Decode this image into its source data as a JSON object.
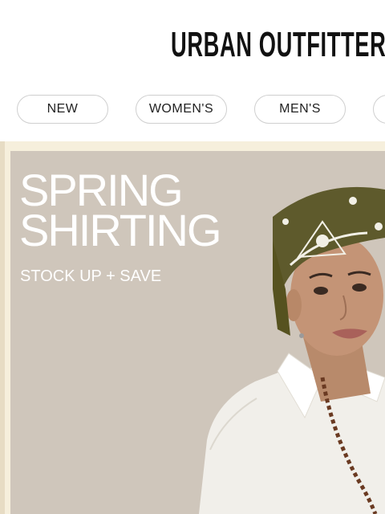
{
  "header": {
    "logo": "URBAN OUTFITTERS"
  },
  "nav": {
    "items": [
      "NEW",
      "WOMEN'S",
      "MEN'S",
      ""
    ]
  },
  "hero": {
    "title_line1": "SPRING",
    "title_line2": "SHIRTING",
    "subtitle": "STOCK UP + SAVE",
    "image": "man-in-bandana-and-knit-shirt",
    "colors": {
      "banner": "#f6efdc",
      "panel": "#cfc6bb",
      "bandana": "#5e5a2c",
      "text": "#ffffff"
    }
  }
}
